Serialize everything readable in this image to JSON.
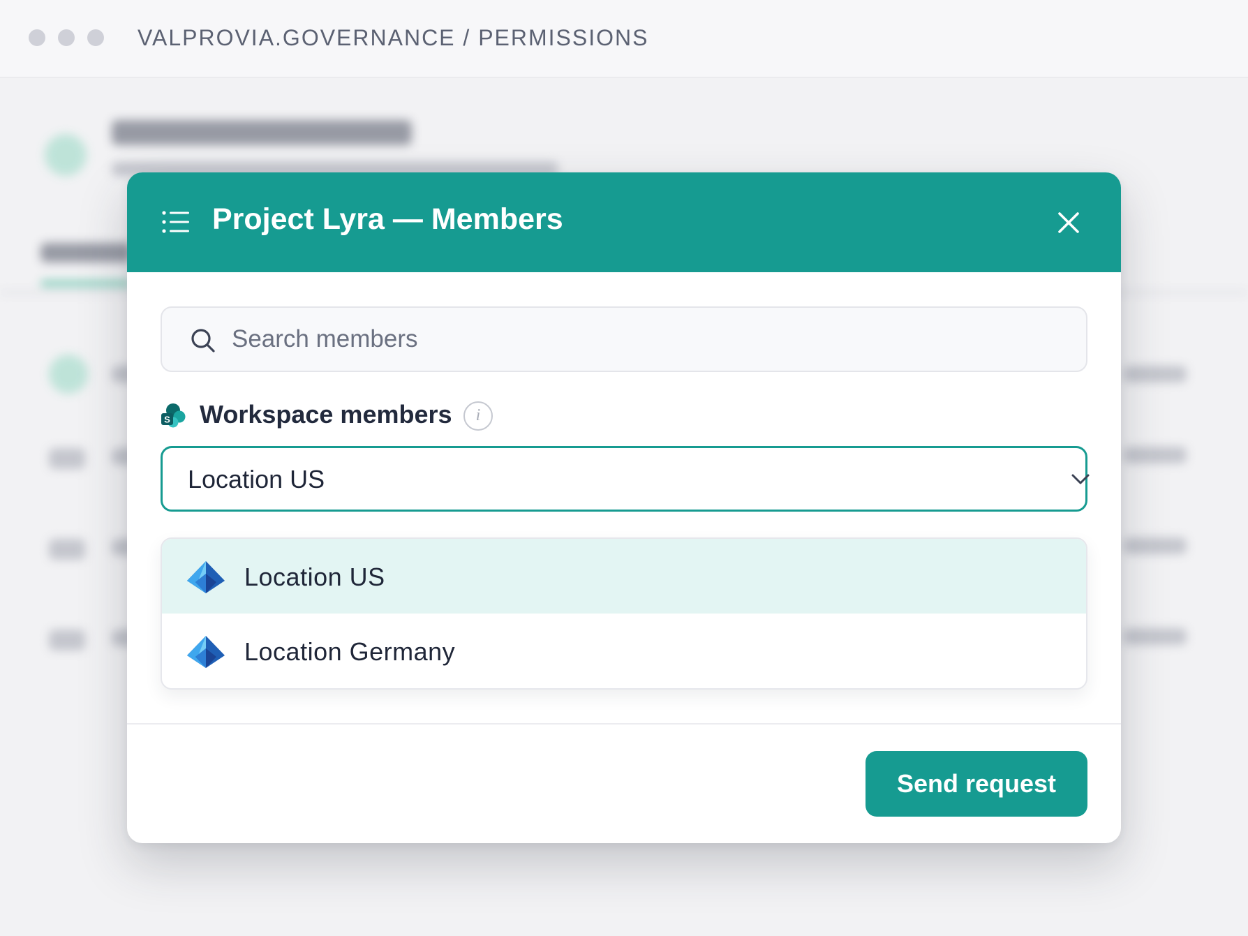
{
  "window": {
    "breadcrumb": "VALPROVIA.GOVERNANCE / PERMISSIONS"
  },
  "modal": {
    "title": "Project Lyra — Members",
    "menu_icon": "list-icon",
    "close_icon": "close-icon",
    "search": {
      "placeholder": "Search members",
      "value": "",
      "icon": "search-icon"
    },
    "section": {
      "label": "Workspace members",
      "icon": "sharepoint-icon",
      "info_icon": "info-icon",
      "info_glyph": "i"
    },
    "select": {
      "value": "Location US",
      "icon": "chevron-down-icon"
    },
    "options": [
      {
        "label": "Location US",
        "icon": "azure-ad-icon",
        "selected": true
      },
      {
        "label": "Location Germany",
        "icon": "azure-ad-icon",
        "selected": false
      }
    ],
    "send_button_label": "Send request"
  },
  "colors": {
    "accent": "#169b91",
    "selected_bg": "#e3f5f3",
    "page_bg": "#f2f2f4"
  }
}
